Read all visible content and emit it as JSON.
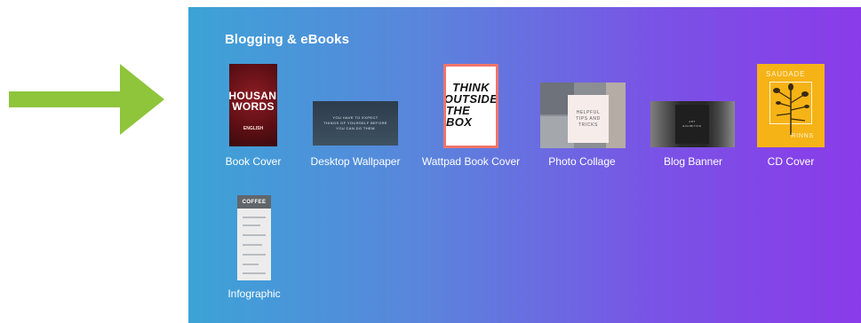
{
  "arrow": {
    "color": "#8ec53b",
    "icon": "right-arrow-icon"
  },
  "panel": {
    "gradient_start": "#3ca3d6",
    "gradient_end": "#8a3be9",
    "title": "Blogging & eBooks"
  },
  "items": [
    {
      "label": "Book Cover",
      "thumb_lines": [
        "A THOUSAND",
        "WORDS",
        "",
        "ENGLISH"
      ]
    },
    {
      "label": "Desktop Wallpaper",
      "thumb_lines": [
        "YOU HAVE TO EXPECT",
        "THINGS OF YOURSELF BEFORE",
        "YOU CAN DO THEM"
      ]
    },
    {
      "label": "Wattpad Book Cover",
      "thumb_lines": [
        "THINK",
        "OUTSIDE",
        "THE BOX"
      ]
    },
    {
      "label": "Photo Collage",
      "thumb_lines": [
        "HELPFUL",
        "TIPS AND",
        "TRICKS"
      ]
    },
    {
      "label": "Blog Banner",
      "thumb_lines": [
        "ART",
        "EXHIBITION"
      ]
    },
    {
      "label": "CD Cover",
      "thumb_lines": [
        "SAUDADE",
        "RINNS"
      ]
    },
    {
      "label": "Infographic",
      "thumb_lines": [
        "COFFEE"
      ]
    }
  ]
}
